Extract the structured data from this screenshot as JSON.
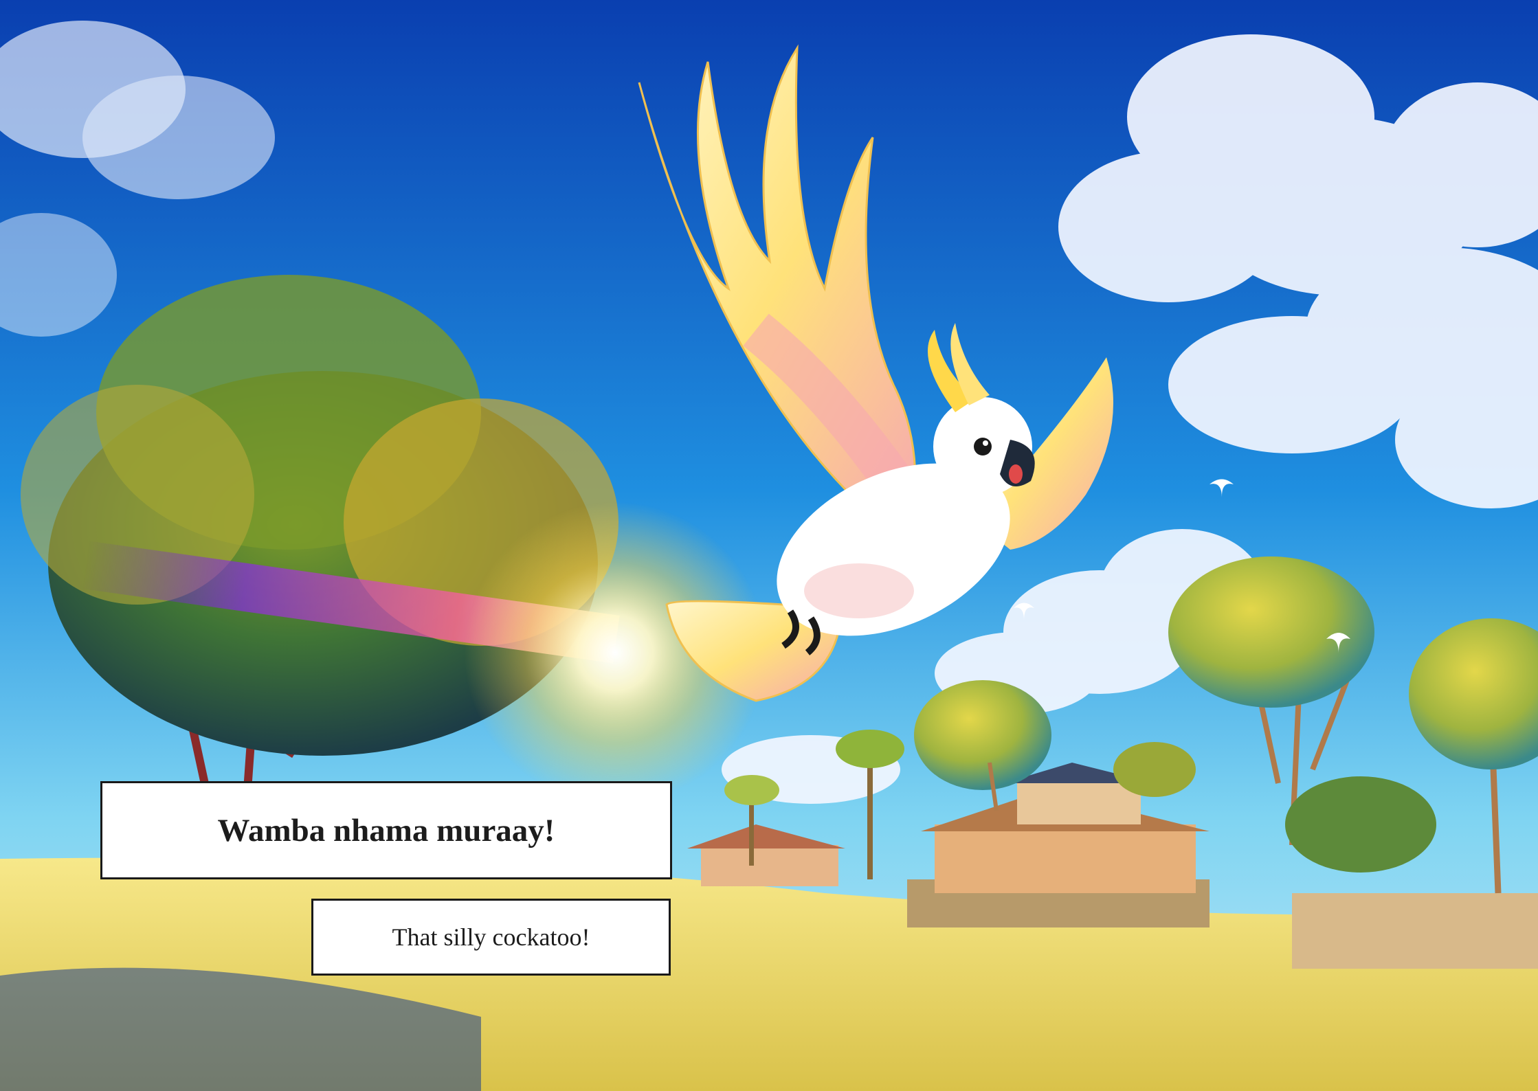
{
  "illustration": {
    "subject": "cockatoo",
    "colors": {
      "sky_top": "#0a3fb0",
      "sky_mid": "#1f8fe0",
      "sky_low": "#7fd4f2",
      "cloud": "#f4f7ff",
      "ground": "#f2df6a",
      "tree_dark": "#2e6b3a",
      "tree_light": "#d4c43a",
      "feather_yellow": "#ffe27a",
      "feather_white": "#ffffff",
      "sun": "#fff7c8",
      "roof": "#b57a4a",
      "house_wall": "#e6b07a"
    }
  },
  "captions": {
    "primary": "Wamba nhama muraay!",
    "secondary": "That silly cockatoo!"
  }
}
